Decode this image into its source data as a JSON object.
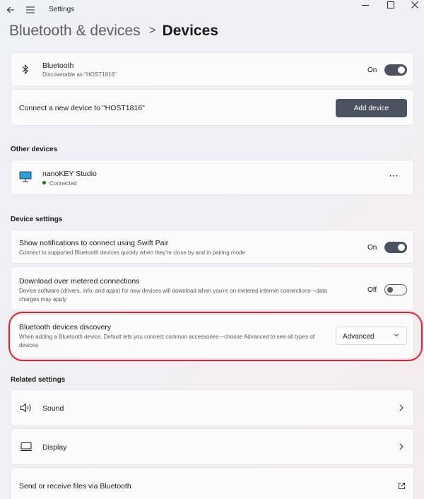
{
  "window": {
    "title": "Settings",
    "back_icon": "back-arrow-icon",
    "menu_icon": "hamburger-menu-icon"
  },
  "breadcrumb": {
    "parent": "Bluetooth & devices",
    "separator": ">",
    "current": "Devices"
  },
  "bluetooth": {
    "title": "Bluetooth",
    "subtitle": "Discoverable as \"HOST1816\"",
    "toggle_label": "On",
    "toggle_on": true
  },
  "connect": {
    "text": "Connect a new device to \"HOST1816\"",
    "button_label": "Add device"
  },
  "other_devices": {
    "heading": "Other devices",
    "items": [
      {
        "name": "nanoKEY Studio",
        "status": "Connected",
        "icon": "monitor-icon",
        "more": "···"
      }
    ]
  },
  "device_settings": {
    "heading": "Device settings",
    "swift_pair": {
      "title": "Show notifications to connect using Swift Pair",
      "description": "Connect to supported Bluetooth devices quickly when they're close by and in pairing mode",
      "toggle_label": "On",
      "toggle_on": true
    },
    "metered": {
      "title": "Download over metered connections",
      "description": "Device software (drivers, info, and apps) for new devices will download when you're on metered internet connections—data charges may apply",
      "toggle_label": "Off",
      "toggle_on": false
    },
    "discovery": {
      "title": "Bluetooth devices discovery",
      "description": "When adding a Bluetooth device, Default lets you connect common accessories—choose Advanced to see all types of devices",
      "selected": "Advanced"
    }
  },
  "related_settings": {
    "heading": "Related settings",
    "items": [
      {
        "label": "Sound",
        "icon": "speaker-icon",
        "action": "chevron-right-icon"
      },
      {
        "label": "Display",
        "icon": "display-icon",
        "action": "chevron-right-icon"
      },
      {
        "label": "Send or receive files via Bluetooth",
        "action": "external-link-icon"
      }
    ]
  },
  "colors": {
    "accent": "#4b5260",
    "highlight": "#e3202b",
    "status_connected": "#0f7b0f"
  }
}
